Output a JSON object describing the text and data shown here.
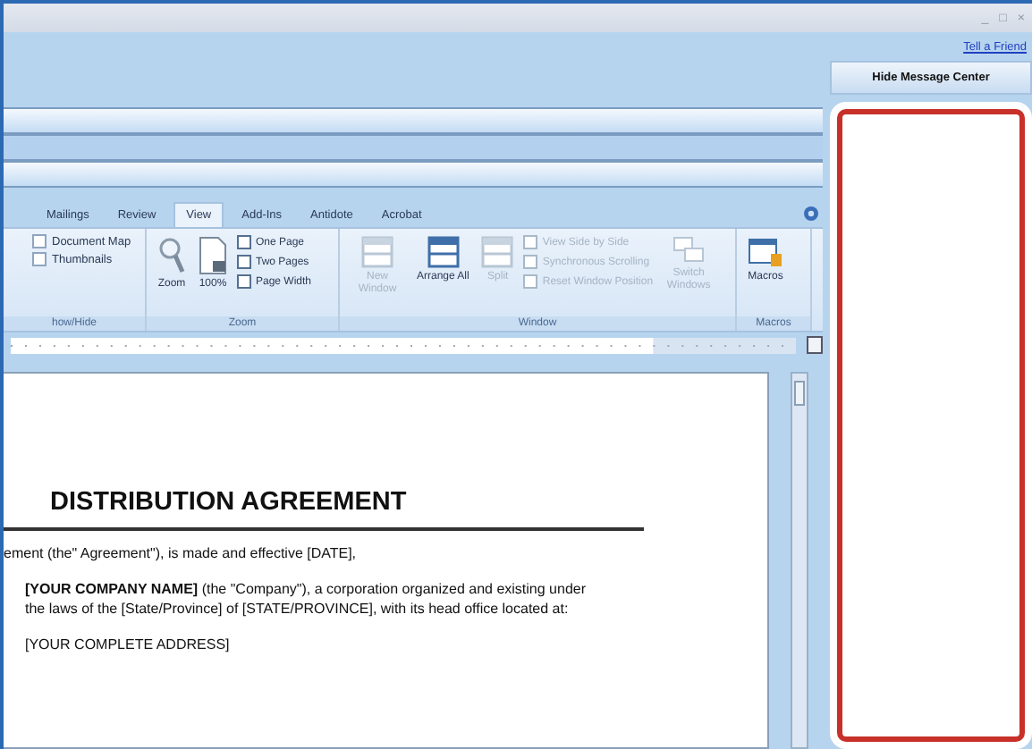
{
  "title_bar": {
    "controls": [
      "_",
      "□",
      "×"
    ]
  },
  "top": {
    "link": "Tell a Friend",
    "hide_button": "Hide Message Center"
  },
  "tabs": [
    {
      "label": "Mailings",
      "selected": false
    },
    {
      "label": "Review",
      "selected": false
    },
    {
      "label": "View",
      "selected": true
    },
    {
      "label": "Add-Ins",
      "selected": false
    },
    {
      "label": "Antidote",
      "selected": false
    },
    {
      "label": "Acrobat",
      "selected": false
    }
  ],
  "groups": [
    {
      "label": "how/Hide",
      "items": [
        {
          "label": "Document Map",
          "checked": false
        },
        {
          "label": "Thumbnails",
          "checked": false
        }
      ]
    },
    {
      "label": "Zoom",
      "items": [
        {
          "label": "Zoom"
        },
        {
          "label": "100%"
        },
        {
          "label": "One Page"
        },
        {
          "label": "Two Pages"
        },
        {
          "label": "Page Width"
        }
      ]
    },
    {
      "label": "Window",
      "items": [
        {
          "label": "New Window",
          "disabled": true
        },
        {
          "label": "Arrange All",
          "disabled": false
        },
        {
          "label": "Split",
          "disabled": true
        },
        {
          "label": "View Side by Side",
          "disabled": true
        },
        {
          "label": "Synchronous Scrolling",
          "disabled": true
        },
        {
          "label": "Reset Window Position",
          "disabled": true
        },
        {
          "label": "Switch Windows",
          "disabled": true
        }
      ]
    },
    {
      "label": "Macros",
      "items": [
        {
          "label": "Macros"
        }
      ]
    }
  ],
  "document": {
    "title": "DISTRIBUTION AGREEMENT",
    "paragraphs": [
      "ement (the\" Agreement\"), is made and effective [DATE],",
      "**[YOUR COMPANY NAME]** (the \"Company\"), a corporation organized and existing under the laws of the [State/Province] of [STATE/PROVINCE],  with its head office located at:",
      "[YOUR COMPLETE ADDRESS]"
    ]
  }
}
